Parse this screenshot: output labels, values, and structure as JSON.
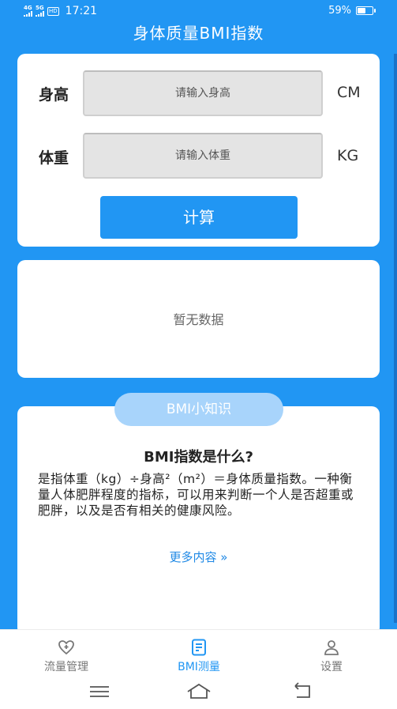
{
  "status_bar": {
    "network_1": "4G",
    "network_2": "5G",
    "hd": "HD",
    "time": "17:21",
    "battery_text": "59%",
    "battery_level": 0.59
  },
  "header": {
    "title": "身体质量BMI指数"
  },
  "form": {
    "height_label": "身高",
    "height_placeholder": "请输入身高",
    "height_unit": "CM",
    "weight_label": "体重",
    "weight_placeholder": "请输入体重",
    "weight_unit": "KG",
    "calculate_label": "计算"
  },
  "result": {
    "empty_text": "暂无数据"
  },
  "info": {
    "pill_label": "BMI小知识",
    "title": "BMI指数是什么?",
    "body": "是指体重（kg）÷身高²（m²）＝身体质量指数。一种衡量人体肥胖程度的指标，可以用来判断一个人是否超重或肥胖，以及是否有相关的健康风险。",
    "more_label": "更多内容 »"
  },
  "tabs": [
    {
      "label": "流量管理",
      "icon": "heart-plus-icon",
      "active": false
    },
    {
      "label": "BMI测量",
      "icon": "document-icon",
      "active": true
    },
    {
      "label": "设置",
      "icon": "person-icon",
      "active": false
    }
  ],
  "colors": {
    "primary": "#2196f3",
    "pill": "#a8d4fb",
    "link": "#1e88e5"
  }
}
